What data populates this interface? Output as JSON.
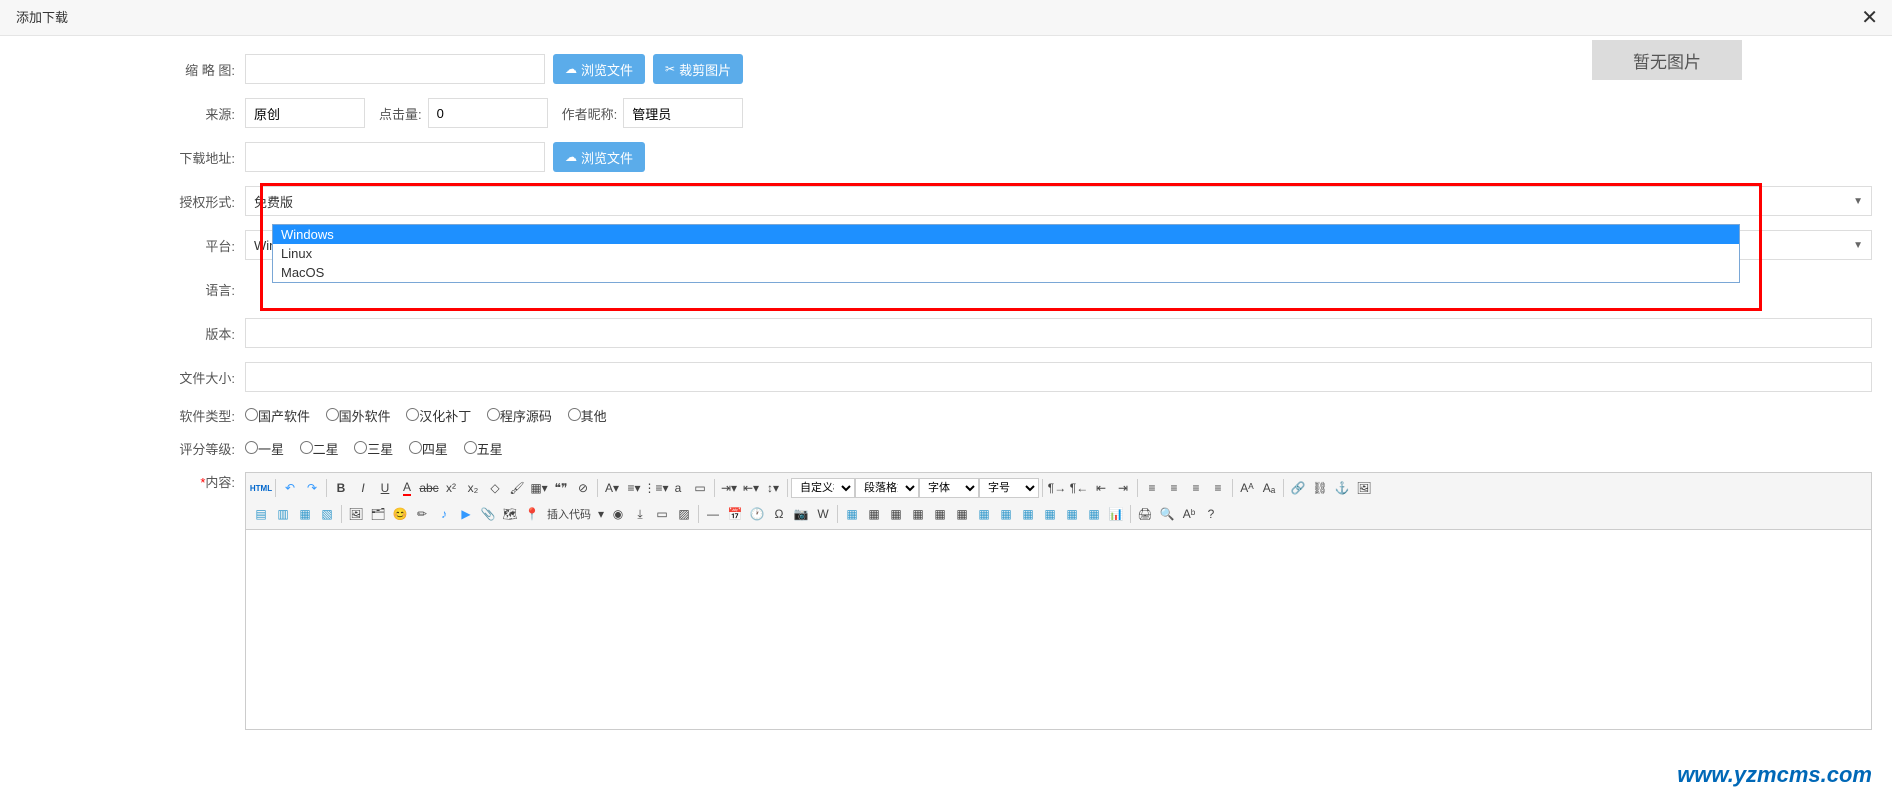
{
  "header": {
    "title": "添加下载",
    "close": "✕"
  },
  "img_placeholder": "暂无图片",
  "watermark": "www.yzmcms.com",
  "labels": {
    "thumbnail": "缩 略 图:",
    "source": "来源:",
    "clicks": "点击量:",
    "author": "作者昵称:",
    "download_url": "下载地址:",
    "license": "授权形式:",
    "platform": "平台:",
    "language": "语言:",
    "version": "版本:",
    "filesize": "文件大小:",
    "softtype": "软件类型:",
    "rating": "评分等级:",
    "content": "内容:"
  },
  "buttons": {
    "browse": "浏览文件",
    "crop": "裁剪图片",
    "insert_code": "插入代码"
  },
  "fields": {
    "source": "原创",
    "clicks": "0",
    "author": "管理员",
    "license_selected": "免费版",
    "platform_selected": "Windows"
  },
  "platform_options": [
    "Windows",
    "Linux",
    "MacOS"
  ],
  "softtype_options": [
    "国产软件",
    "国外软件",
    "汉化补丁",
    "程序源码",
    "其他"
  ],
  "rating_options": [
    "一星",
    "二星",
    "三星",
    "四星",
    "五星"
  ],
  "toolbar": {
    "html": "HTML",
    "font_family": "字体",
    "font_size": "字号",
    "heading": "自定义标题",
    "paragraph": "段落格式"
  }
}
